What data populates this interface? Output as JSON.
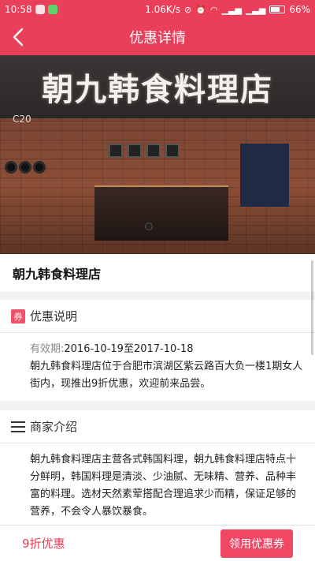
{
  "status_bar": {
    "time": "10:58",
    "speed": "1.06K/s",
    "battery_text": "66%",
    "battery_level": 0.66
  },
  "nav": {
    "title": "优惠详情"
  },
  "hero": {
    "sign_text": "朝九韩食料理店",
    "sign_code": "C20"
  },
  "store": {
    "name": "朝九韩食料理店"
  },
  "offer": {
    "badge": "券",
    "section_title": "优惠说明",
    "validity_label": "有效期:",
    "validity_value": "2016-10-19至2017-10-18",
    "description": "朝九韩食料理店位于合肥市滨湖区紫云路百大负一楼1期女人街内，现推出9折优惠，欢迎前来品尝。"
  },
  "intro": {
    "section_title": "商家介绍",
    "text": "朝九韩食料理店主营各式韩国料理，朝九韩食料理店特点十分鲜明，韩国料理是清淡、少油腻、无味精、营养、品种丰富的料理。选材天然素荤搭配合理追求少而精，保证足够的营养，不会令人暴饮暴食。"
  },
  "bottom": {
    "discount_label": "9折优惠",
    "get_button": "领用优惠券"
  },
  "colors": {
    "brand": "#e93f5a",
    "button": "#f04864"
  }
}
